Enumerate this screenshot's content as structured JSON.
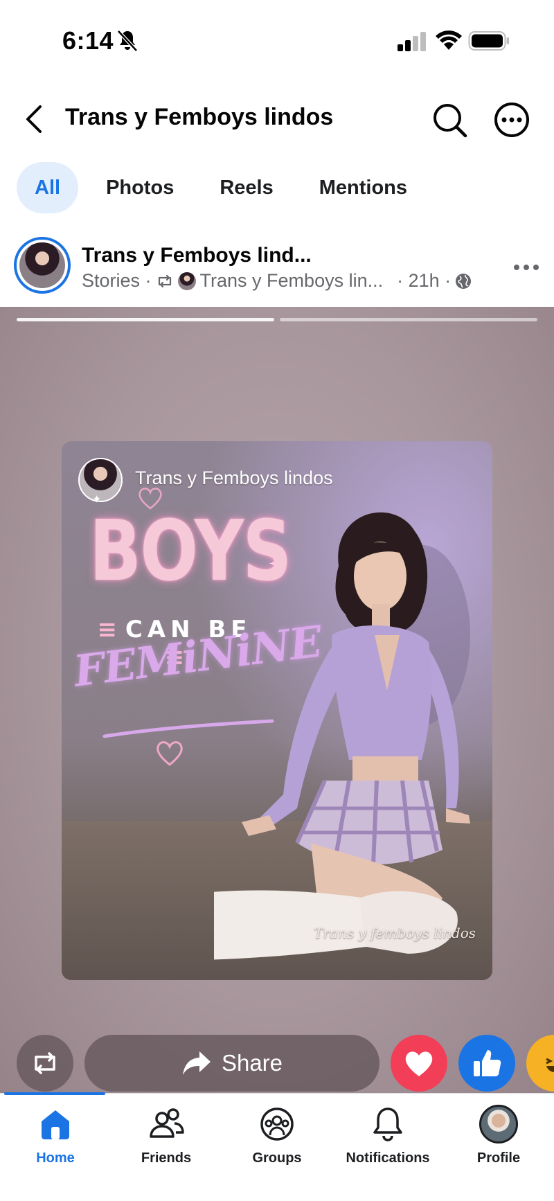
{
  "status_bar": {
    "time": "6:14",
    "icons": [
      "bell-muted-icon",
      "signal-icon",
      "wifi-icon",
      "battery-icon"
    ]
  },
  "header": {
    "title": "Trans y Femboys lindos",
    "icons": [
      "back-arrow-icon",
      "search-icon",
      "more-icon"
    ]
  },
  "tabs": [
    {
      "label": "All",
      "active": true
    },
    {
      "label": "Photos",
      "active": false
    },
    {
      "label": "Reels",
      "active": false
    },
    {
      "label": "Mentions",
      "active": false
    }
  ],
  "post": {
    "author": "Trans y Femboys lind...",
    "meta_stories": "Stories ·",
    "meta_shared_from": "Trans y Femboys lin...",
    "meta_time": "· 21h ·",
    "privacy_icon": "globe-icon"
  },
  "story": {
    "card_author": "Trans y Femboys lindos",
    "poster_line1": "BOYS",
    "poster_line2": "CAN BE",
    "poster_line3": "FEMiNiNE",
    "watermark": "Trans y femboys lindos",
    "progress_segments": 2
  },
  "actions": {
    "share_label": "Share",
    "reactions": [
      "love",
      "like",
      "haha"
    ]
  },
  "nav": [
    {
      "label": "Home",
      "icon": "home-icon",
      "active": true
    },
    {
      "label": "Friends",
      "icon": "friends-icon",
      "active": false
    },
    {
      "label": "Groups",
      "icon": "groups-icon",
      "active": false
    },
    {
      "label": "Notifications",
      "icon": "bell-icon",
      "active": false
    },
    {
      "label": "Profile",
      "icon": "profile-avatar",
      "active": false
    }
  ],
  "colors": {
    "accent": "#1b74e4",
    "tab_active_bg": "#e3eefc",
    "love": "#f33e58",
    "like": "#1b74e4",
    "haha": "#f7b125"
  }
}
